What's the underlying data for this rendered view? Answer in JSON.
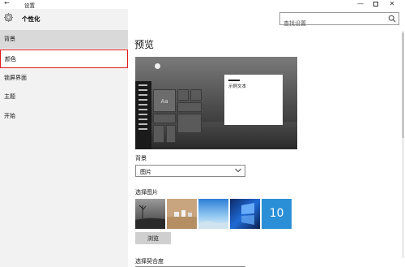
{
  "window": {
    "title": "设置",
    "back_glyph": "←",
    "min_glyph": "—",
    "close_glyph": "✕"
  },
  "header": {
    "label": "个性化"
  },
  "search": {
    "placeholder": "查找设置"
  },
  "nav": {
    "items": [
      {
        "label": "背景"
      },
      {
        "label": "颜色"
      },
      {
        "label": "锁屏界面"
      },
      {
        "label": "主题"
      },
      {
        "label": "开始"
      }
    ]
  },
  "main": {
    "preview_heading": "预览",
    "preview_window_text": "示例文本",
    "preview_tile_text": "Aa",
    "background_label": "背景",
    "background_value": "图片",
    "choose_picture_label": "选择图片",
    "thumb5_text": "10",
    "browse_label": "浏览",
    "fit_label": "选择契合度"
  },
  "colors": {
    "highlight_border": "#e01b1b",
    "active_nav_bg": "#d9d9d9",
    "left_pane_bg": "#f2f2f2"
  },
  "icons": [
    "back-arrow-icon",
    "gear-icon",
    "search-icon",
    "chevron-down-icon",
    "minimize-icon",
    "maximize-icon",
    "close-icon"
  ]
}
